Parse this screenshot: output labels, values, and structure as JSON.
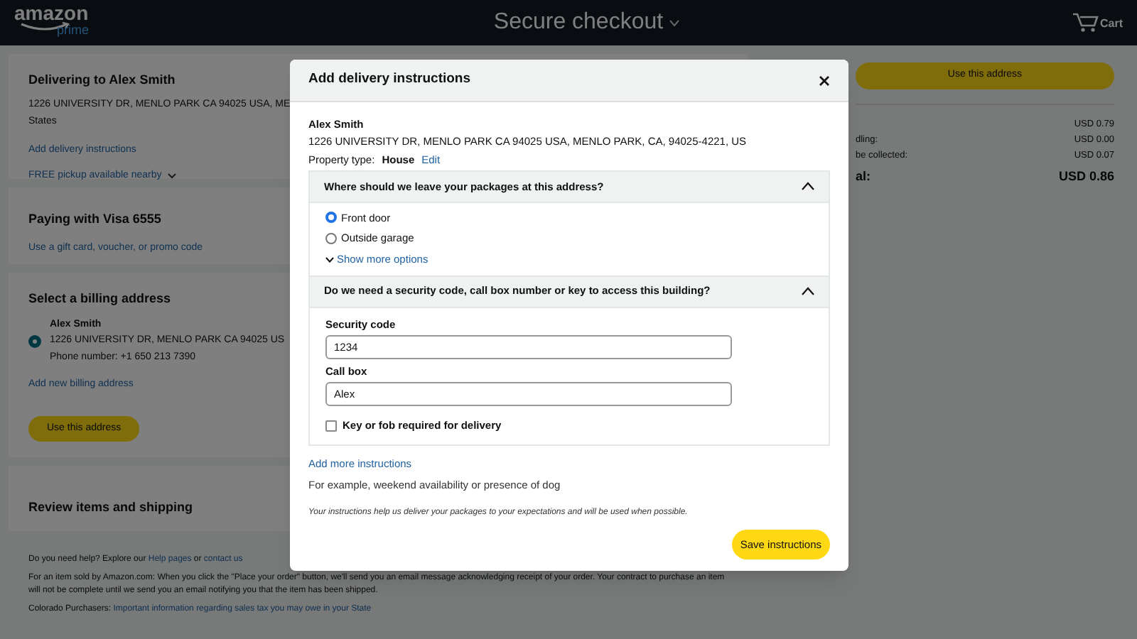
{
  "header": {
    "logo": "amazon",
    "logo_sub": "prime",
    "title": "Secure checkout",
    "cart": "Cart"
  },
  "delivery": {
    "heading": "Delivering to Alex Smith",
    "address": "1226 UNIVERSITY DR, MENLO PARK CA 94025 USA, ME",
    "address_cont": "States",
    "link": "Add delivery instructions",
    "pickup": "FREE pickup available nearby"
  },
  "payment": {
    "heading": "Paying with Visa 6555",
    "link": "Use a gift card, voucher, or promo code"
  },
  "billing": {
    "heading": "Select a billing address",
    "options": [
      {
        "name": "Alex Smith",
        "address": "1226 UNIVERSITY DR, MENLO PARK CA 94025 US",
        "phone": "Phone number: +1 650 213 7390",
        "selected": true
      }
    ],
    "add_link": "Add new billing address",
    "button": "Use this address"
  },
  "review": {
    "heading": "Review items and shipping"
  },
  "footer": {
    "help_prefix": "Do you need help? Explore our",
    "help_link": "Help pages",
    "help_or": "or",
    "contact_link": "contact us",
    "notice": "For an item sold by Amazon.com: When you click the \"Place your order\" button, we'll send you an email message acknowledging receipt of your order. Your contract to purchase an item will not be complete until we send you an email notifying you that the item has been shipped.",
    "colorado_label": "Colorado Purchasers:",
    "colorado_link": "Important information regarding sales tax you may owe in your State"
  },
  "summary": {
    "button": "Use this address",
    "rows": [
      {
        "label": "",
        "value": "USD 0.79"
      },
      {
        "label": "dling:",
        "value": "USD 0.00"
      },
      {
        "label": "be collected:",
        "value": "USD 0.07"
      }
    ],
    "total": {
      "label": "al:",
      "value": "USD 0.86"
    }
  },
  "modal": {
    "title": "Add delivery instructions",
    "recipient": "Alex Smith",
    "address": "1226 UNIVERSITY DR, MENLO PARK CA 94025 USA, MENLO PARK, CA, 94025-4221, US",
    "property_label": "Property type:",
    "property_value": "House",
    "edit_link": "Edit",
    "sections": [
      {
        "kind": "radio",
        "question": "Where should we leave your packages at this address?",
        "expanded": true,
        "options": [
          {
            "label": "Front door",
            "selected": true
          },
          {
            "label": "Outside garage",
            "selected": false
          }
        ],
        "more_link": "Show more options"
      },
      {
        "kind": "fields",
        "question": "Do we need a security code, call box number or key to access this building?",
        "expanded": true,
        "fields": [
          {
            "label": "Security code",
            "value": "1234"
          },
          {
            "label": "Call box",
            "value": "Alex"
          }
        ],
        "checkbox": {
          "label": "Key or fob required for delivery",
          "checked": false
        }
      }
    ],
    "add_more_link": "Add more instructions",
    "add_more_hint": "For example, weekend availability or presence of dog",
    "note": "Your instructions help us deliver your packages to your expectations and will be used when possible.",
    "save_button": "Save instructions"
  }
}
